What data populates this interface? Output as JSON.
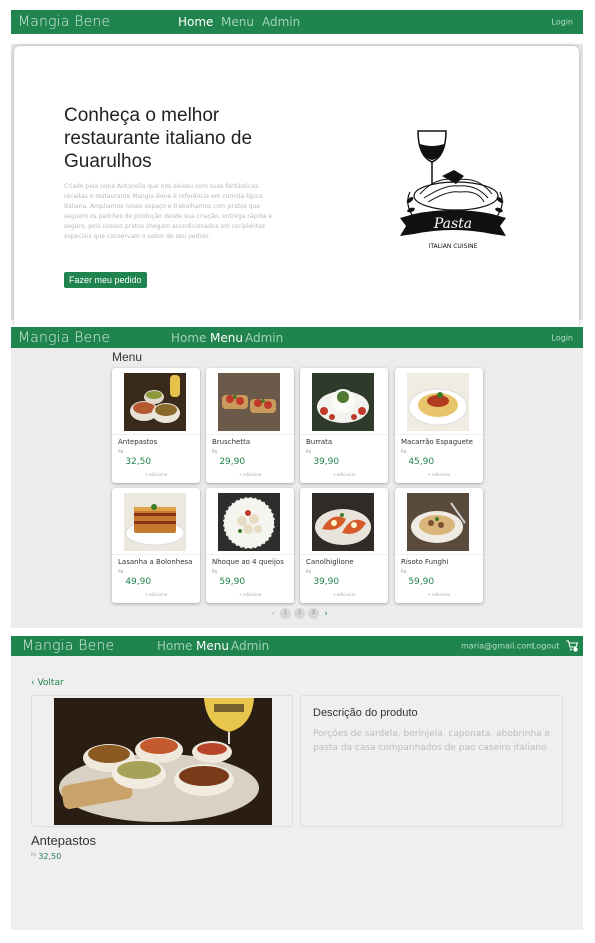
{
  "colors": {
    "brand": "#20844f",
    "panel": "#ececec"
  },
  "nav": {
    "brand": "Mangia Bene",
    "links": [
      "Home",
      "Menu",
      "Admin"
    ],
    "login": "Login",
    "email": "maria@gmail.com",
    "logout": "Logout"
  },
  "hero": {
    "title": "Conheça o melhor restaurante italiano de Guarulhos",
    "text": "Criado pela nona Antonella que nos deixou com suas fantásticas receitas o restaurante Mangia Bene é referência em comida típica italiana. Ampliamos nosso espaço e trabalhamos com pratos que seguem os padrões de produção desde sua criação, entrega rápida e seguro, pois nossos pratos chegam acondicionados em recipientes especiais que conservam o sabor de seu pedido.",
    "button": "Fazer meu pedido",
    "logo_text": "Pasta",
    "logo_subtext": "ITALIAN CUISINE"
  },
  "menu": {
    "heading": "Menu",
    "currency": "R$",
    "add_label": "+ adicionar",
    "items": [
      {
        "name": "Antepastos",
        "price": "32,50"
      },
      {
        "name": "Bruschetta",
        "price": "29,90"
      },
      {
        "name": "Burrata",
        "price": "39,90"
      },
      {
        "name": "Macarrão Espaguete",
        "price": "45,90"
      },
      {
        "name": "Lasanha a Bolonhesa",
        "price": "49,90"
      },
      {
        "name": "Nhoque ao 4 queijos",
        "price": "59,90"
      },
      {
        "name": "Canolhiglione",
        "price": "39,90"
      },
      {
        "name": "Risoto Funghi",
        "price": "59,90"
      }
    ],
    "pagination": {
      "prev": "‹",
      "pages": [
        "1",
        "2",
        "3"
      ],
      "next": "›"
    }
  },
  "detail": {
    "back": "‹ Voltar",
    "desc_title": "Descrição do produto",
    "desc_text": "Porções de sardela, berinjela, caponata, abobrinha e pasta da casa companhados de pao caseiro italiano",
    "name": "Antepastos",
    "currency": "R$",
    "price": "32,50"
  },
  "icons": [
    "pasta-logo-icon",
    "cart-icon",
    "chevron-left-icon",
    "chevron-right-icon"
  ]
}
